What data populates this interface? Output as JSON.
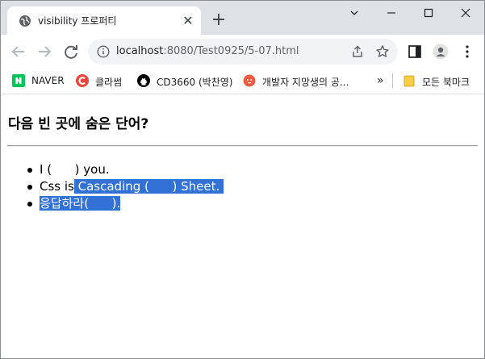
{
  "tab": {
    "title": "visibility 프로퍼티"
  },
  "address_bar": {
    "url_host": "localhost",
    "url_rest": ":8080/Test0925/5-07.html"
  },
  "bookmarks": [
    {
      "label": "NAVER",
      "icon": "naver-icon",
      "color": "#03c75a"
    },
    {
      "label": "클라썸",
      "icon": "classum-icon",
      "color": "#e8443a"
    },
    {
      "label": "CD3660 (박찬영)",
      "icon": "github-icon",
      "color": "#000000"
    },
    {
      "label": "개발자 지망생의 공...",
      "icon": "blog-icon",
      "color": "#f05a40"
    },
    {
      "label": "모든 북마크",
      "icon": "folder-icon",
      "color": "#f7cd46"
    }
  ],
  "page": {
    "heading": "다음 빈 곳에 숨은 단어?",
    "items": [
      {
        "before": "I (",
        "hidden": "      ",
        "after": ") you.",
        "selected": ""
      },
      {
        "before": "Css is",
        "selected": " Cascading (      ) Sheet. "
      },
      {
        "before": "",
        "selected": "응답하라(      )."
      }
    ]
  },
  "colors": {
    "selection": "#3271d6",
    "tabstrip": "#dee1e6",
    "omnibox": "#f1f3f4"
  }
}
